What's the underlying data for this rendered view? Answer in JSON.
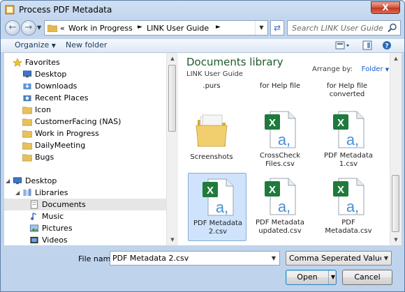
{
  "window": {
    "title": "Process PDF Metadata",
    "close_glyph": "X"
  },
  "address": {
    "overflow": "«",
    "breadcrumbs": [
      "Work in Progress",
      "LINK User Guide"
    ]
  },
  "search": {
    "placeholder": "Search LINK User Guide"
  },
  "toolbar": {
    "organize": "Organize",
    "new_folder": "New folder"
  },
  "nav": {
    "items": [
      {
        "label": "Favorites",
        "icon": "star-icon",
        "indent": 0
      },
      {
        "label": "Desktop",
        "icon": "desktop-icon",
        "indent": 1
      },
      {
        "label": "Downloads",
        "icon": "downloads-icon",
        "indent": 1
      },
      {
        "label": "Recent Places",
        "icon": "recent-places-icon",
        "indent": 1
      },
      {
        "label": "Icon",
        "icon": "folder-icon",
        "indent": 1
      },
      {
        "label": "CustomerFacing (NAS)",
        "icon": "folder-icon",
        "indent": 1
      },
      {
        "label": "Work in Progress",
        "icon": "folder-icon",
        "indent": 1
      },
      {
        "label": "DailyMeeting",
        "icon": "folder-icon",
        "indent": 1
      },
      {
        "label": "Bugs",
        "icon": "folder-icon",
        "indent": 1
      },
      {
        "label": "Desktop",
        "icon": "desktop-icon",
        "indent": 0
      },
      {
        "label": "Libraries",
        "icon": "libraries-icon",
        "indent": 1
      },
      {
        "label": "Documents",
        "icon": "documents-icon",
        "indent": 2,
        "selected": true
      },
      {
        "label": "Music",
        "icon": "music-icon",
        "indent": 2
      },
      {
        "label": "Pictures",
        "icon": "pictures-icon",
        "indent": 2
      },
      {
        "label": "Videos",
        "icon": "videos-icon",
        "indent": 2
      }
    ]
  },
  "content": {
    "library_title": "Documents library",
    "library_subtitle": "LINK User Guide",
    "arrange_label": "Arrange by:",
    "arrange_value": "Folder",
    "partial_labels": [
      ".purs",
      "for Help file",
      "for Help file converted"
    ],
    "files": [
      {
        "label": "Screenshots",
        "type": "folder-icon"
      },
      {
        "label": "CrossCheck Files.csv",
        "type": "excel-csv-icon"
      },
      {
        "label": "PDF Metadata 1.csv",
        "type": "excel-csv-icon"
      },
      {
        "label": "PDF Metadata 2.csv",
        "type": "excel-csv-icon",
        "selected": true
      },
      {
        "label": "PDF Metadata updated.csv",
        "type": "excel-csv-icon"
      },
      {
        "label": "PDF Metadata.csv",
        "type": "excel-csv-icon"
      }
    ]
  },
  "bottom": {
    "file_name_label": "File name:",
    "file_name_value": "PDF Metadata 2.csv",
    "file_type_value": "Comma Seperated Value (*.csv)",
    "open_label": "Open",
    "cancel_label": "Cancel"
  },
  "colors": {
    "library_title": "#1e5a2a",
    "arrange_value": "#1e5ecf",
    "selection": "#cfe3fc"
  }
}
